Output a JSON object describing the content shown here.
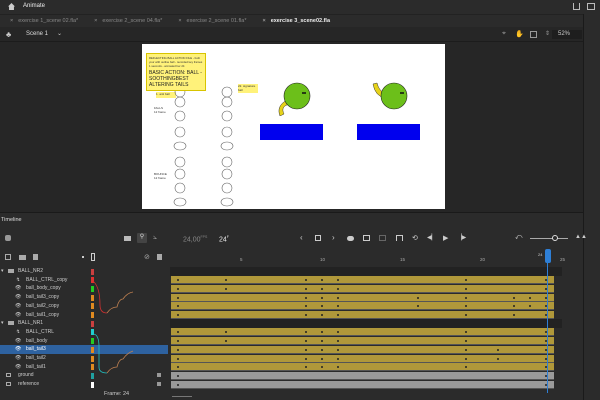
{
  "app": {
    "title": "Animate"
  },
  "tabs": [
    {
      "label": "exercise 1_scene 02.fla*",
      "active": false
    },
    {
      "label": "exercise 2_scene 04.fla*",
      "active": false
    },
    {
      "label": "exercise 2_scene 01.fla*",
      "active": false
    },
    {
      "label": "exercise 3_scene02.fla",
      "active": true
    }
  ],
  "scene": {
    "label": "Scene 1",
    "zoom": "52%"
  },
  "stage_notes": {
    "note1": "REFLECTING BALL ACTION FILE - built your with outline ball - recorded key frames 1 seconds - animated ber 24",
    "note2": "BASIC ACTION: BALL - SOOTHINGBEST ALTERING TAILS",
    "note3": "1. anti ball",
    "note4": "22. signature ball",
    "label_fall": "FALLS",
    "label_fall2": "12 frame",
    "label_bounce": "BOUNCE",
    "label_bounce2": "12 frame"
  },
  "timeline": {
    "title": "Timeline",
    "fps": "24,00",
    "fps_unit": "FPS",
    "frame": "24",
    "frame_unit": "F",
    "current_frame": 24,
    "total_frames": 25,
    "frame_status": "Frame: 24",
    "ruler": [
      "5",
      "10",
      "15",
      "20",
      "25"
    ],
    "playhead_label": "24"
  },
  "layers": [
    {
      "name": "BALL_NR2",
      "type": "folder",
      "keys": [],
      "color": "#c94040"
    },
    {
      "name": "BALL_CTRL_copy",
      "type": "motion",
      "keys": [
        1,
        4,
        9,
        10,
        11,
        19,
        24
      ],
      "color": "#e03030"
    },
    {
      "name": "ball_body_copy",
      "type": "layer",
      "keys": [
        1,
        4,
        9,
        10,
        11,
        19,
        24
      ],
      "color": "#22cc22"
    },
    {
      "name": "ball_tail3_copy",
      "type": "layer",
      "keys": [
        1,
        9,
        10,
        11,
        16,
        19,
        22,
        23,
        24
      ],
      "color": "#e08a20"
    },
    {
      "name": "ball_tail2_copy",
      "type": "layer",
      "keys": [
        1,
        9,
        10,
        11,
        16,
        19,
        22,
        23,
        24
      ],
      "color": "#e08a20"
    },
    {
      "name": "ball_tail1_copy",
      "type": "layer",
      "keys": [
        1,
        9,
        10,
        11,
        19,
        22,
        24
      ],
      "color": "#e08a20"
    },
    {
      "name": "BALL_NR1",
      "type": "folder",
      "keys": [],
      "color": "#c94040"
    },
    {
      "name": "BALL_CTRL",
      "type": "motion",
      "keys": [
        1,
        4,
        9,
        10,
        11,
        19,
        24
      ],
      "color": "#20d0d0"
    },
    {
      "name": "ball_body",
      "type": "layer",
      "keys": [
        1,
        4,
        9,
        10,
        11,
        19,
        24
      ],
      "color": "#22cc22"
    },
    {
      "name": "ball_tail3",
      "type": "layer",
      "keys": [
        1,
        9,
        10,
        11,
        19,
        21,
        24
      ],
      "color": "#e08a20",
      "selected": true
    },
    {
      "name": "ball_tail2",
      "type": "layer",
      "keys": [
        1,
        9,
        10,
        11,
        19,
        21,
        24
      ],
      "color": "#e08a20"
    },
    {
      "name": "ball_tail1",
      "type": "layer",
      "keys": [
        1,
        9,
        10,
        11,
        19,
        24
      ],
      "color": "#e08a20"
    },
    {
      "name": "ground",
      "type": "locked",
      "keys": [
        1,
        24
      ],
      "color": "#20a0a0"
    },
    {
      "name": "reference",
      "type": "locked",
      "keys": [
        1,
        24
      ],
      "color": "#ffffff"
    }
  ],
  "colors": {
    "accent": "#2e7fd6",
    "tween": "#b0983a",
    "locked_frames": "#9a9a9a",
    "ball": "#6cbf1a",
    "platform": "#0000ee"
  }
}
